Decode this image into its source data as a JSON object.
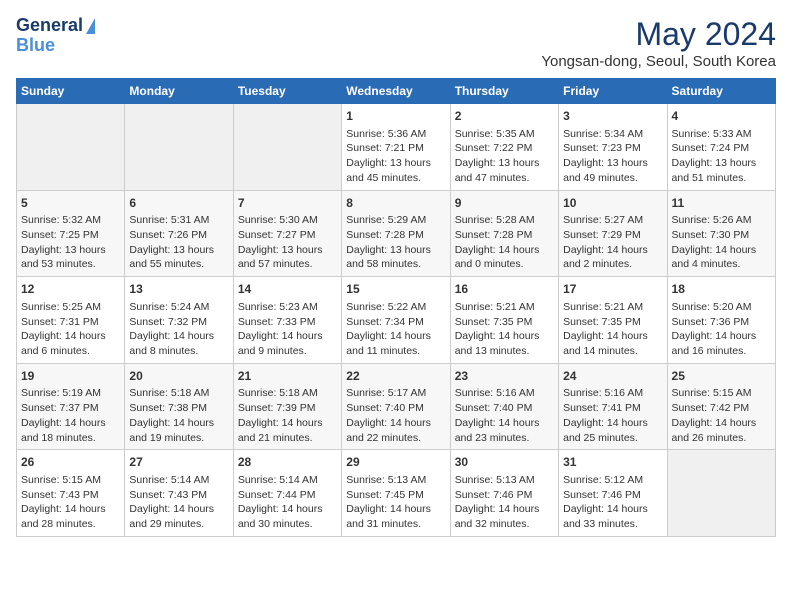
{
  "header": {
    "logo_line1": "General",
    "logo_line2": "Blue",
    "month_title": "May 2024",
    "location": "Yongsan-dong, Seoul, South Korea"
  },
  "weekdays": [
    "Sunday",
    "Monday",
    "Tuesday",
    "Wednesday",
    "Thursday",
    "Friday",
    "Saturday"
  ],
  "weeks": [
    [
      {
        "day": "",
        "empty": true
      },
      {
        "day": "",
        "empty": true
      },
      {
        "day": "",
        "empty": true
      },
      {
        "day": "1",
        "sunrise": "Sunrise: 5:36 AM",
        "sunset": "Sunset: 7:21 PM",
        "daylight": "Daylight: 13 hours and 45 minutes."
      },
      {
        "day": "2",
        "sunrise": "Sunrise: 5:35 AM",
        "sunset": "Sunset: 7:22 PM",
        "daylight": "Daylight: 13 hours and 47 minutes."
      },
      {
        "day": "3",
        "sunrise": "Sunrise: 5:34 AM",
        "sunset": "Sunset: 7:23 PM",
        "daylight": "Daylight: 13 hours and 49 minutes."
      },
      {
        "day": "4",
        "sunrise": "Sunrise: 5:33 AM",
        "sunset": "Sunset: 7:24 PM",
        "daylight": "Daylight: 13 hours and 51 minutes."
      }
    ],
    [
      {
        "day": "5",
        "sunrise": "Sunrise: 5:32 AM",
        "sunset": "Sunset: 7:25 PM",
        "daylight": "Daylight: 13 hours and 53 minutes."
      },
      {
        "day": "6",
        "sunrise": "Sunrise: 5:31 AM",
        "sunset": "Sunset: 7:26 PM",
        "daylight": "Daylight: 13 hours and 55 minutes."
      },
      {
        "day": "7",
        "sunrise": "Sunrise: 5:30 AM",
        "sunset": "Sunset: 7:27 PM",
        "daylight": "Daylight: 13 hours and 57 minutes."
      },
      {
        "day": "8",
        "sunrise": "Sunrise: 5:29 AM",
        "sunset": "Sunset: 7:28 PM",
        "daylight": "Daylight: 13 hours and 58 minutes."
      },
      {
        "day": "9",
        "sunrise": "Sunrise: 5:28 AM",
        "sunset": "Sunset: 7:28 PM",
        "daylight": "Daylight: 14 hours and 0 minutes."
      },
      {
        "day": "10",
        "sunrise": "Sunrise: 5:27 AM",
        "sunset": "Sunset: 7:29 PM",
        "daylight": "Daylight: 14 hours and 2 minutes."
      },
      {
        "day": "11",
        "sunrise": "Sunrise: 5:26 AM",
        "sunset": "Sunset: 7:30 PM",
        "daylight": "Daylight: 14 hours and 4 minutes."
      }
    ],
    [
      {
        "day": "12",
        "sunrise": "Sunrise: 5:25 AM",
        "sunset": "Sunset: 7:31 PM",
        "daylight": "Daylight: 14 hours and 6 minutes."
      },
      {
        "day": "13",
        "sunrise": "Sunrise: 5:24 AM",
        "sunset": "Sunset: 7:32 PM",
        "daylight": "Daylight: 14 hours and 8 minutes."
      },
      {
        "day": "14",
        "sunrise": "Sunrise: 5:23 AM",
        "sunset": "Sunset: 7:33 PM",
        "daylight": "Daylight: 14 hours and 9 minutes."
      },
      {
        "day": "15",
        "sunrise": "Sunrise: 5:22 AM",
        "sunset": "Sunset: 7:34 PM",
        "daylight": "Daylight: 14 hours and 11 minutes."
      },
      {
        "day": "16",
        "sunrise": "Sunrise: 5:21 AM",
        "sunset": "Sunset: 7:35 PM",
        "daylight": "Daylight: 14 hours and 13 minutes."
      },
      {
        "day": "17",
        "sunrise": "Sunrise: 5:21 AM",
        "sunset": "Sunset: 7:35 PM",
        "daylight": "Daylight: 14 hours and 14 minutes."
      },
      {
        "day": "18",
        "sunrise": "Sunrise: 5:20 AM",
        "sunset": "Sunset: 7:36 PM",
        "daylight": "Daylight: 14 hours and 16 minutes."
      }
    ],
    [
      {
        "day": "19",
        "sunrise": "Sunrise: 5:19 AM",
        "sunset": "Sunset: 7:37 PM",
        "daylight": "Daylight: 14 hours and 18 minutes."
      },
      {
        "day": "20",
        "sunrise": "Sunrise: 5:18 AM",
        "sunset": "Sunset: 7:38 PM",
        "daylight": "Daylight: 14 hours and 19 minutes."
      },
      {
        "day": "21",
        "sunrise": "Sunrise: 5:18 AM",
        "sunset": "Sunset: 7:39 PM",
        "daylight": "Daylight: 14 hours and 21 minutes."
      },
      {
        "day": "22",
        "sunrise": "Sunrise: 5:17 AM",
        "sunset": "Sunset: 7:40 PM",
        "daylight": "Daylight: 14 hours and 22 minutes."
      },
      {
        "day": "23",
        "sunrise": "Sunrise: 5:16 AM",
        "sunset": "Sunset: 7:40 PM",
        "daylight": "Daylight: 14 hours and 23 minutes."
      },
      {
        "day": "24",
        "sunrise": "Sunrise: 5:16 AM",
        "sunset": "Sunset: 7:41 PM",
        "daylight": "Daylight: 14 hours and 25 minutes."
      },
      {
        "day": "25",
        "sunrise": "Sunrise: 5:15 AM",
        "sunset": "Sunset: 7:42 PM",
        "daylight": "Daylight: 14 hours and 26 minutes."
      }
    ],
    [
      {
        "day": "26",
        "sunrise": "Sunrise: 5:15 AM",
        "sunset": "Sunset: 7:43 PM",
        "daylight": "Daylight: 14 hours and 28 minutes."
      },
      {
        "day": "27",
        "sunrise": "Sunrise: 5:14 AM",
        "sunset": "Sunset: 7:43 PM",
        "daylight": "Daylight: 14 hours and 29 minutes."
      },
      {
        "day": "28",
        "sunrise": "Sunrise: 5:14 AM",
        "sunset": "Sunset: 7:44 PM",
        "daylight": "Daylight: 14 hours and 30 minutes."
      },
      {
        "day": "29",
        "sunrise": "Sunrise: 5:13 AM",
        "sunset": "Sunset: 7:45 PM",
        "daylight": "Daylight: 14 hours and 31 minutes."
      },
      {
        "day": "30",
        "sunrise": "Sunrise: 5:13 AM",
        "sunset": "Sunset: 7:46 PM",
        "daylight": "Daylight: 14 hours and 32 minutes."
      },
      {
        "day": "31",
        "sunrise": "Sunrise: 5:12 AM",
        "sunset": "Sunset: 7:46 PM",
        "daylight": "Daylight: 14 hours and 33 minutes."
      },
      {
        "day": "",
        "empty": true
      }
    ]
  ]
}
